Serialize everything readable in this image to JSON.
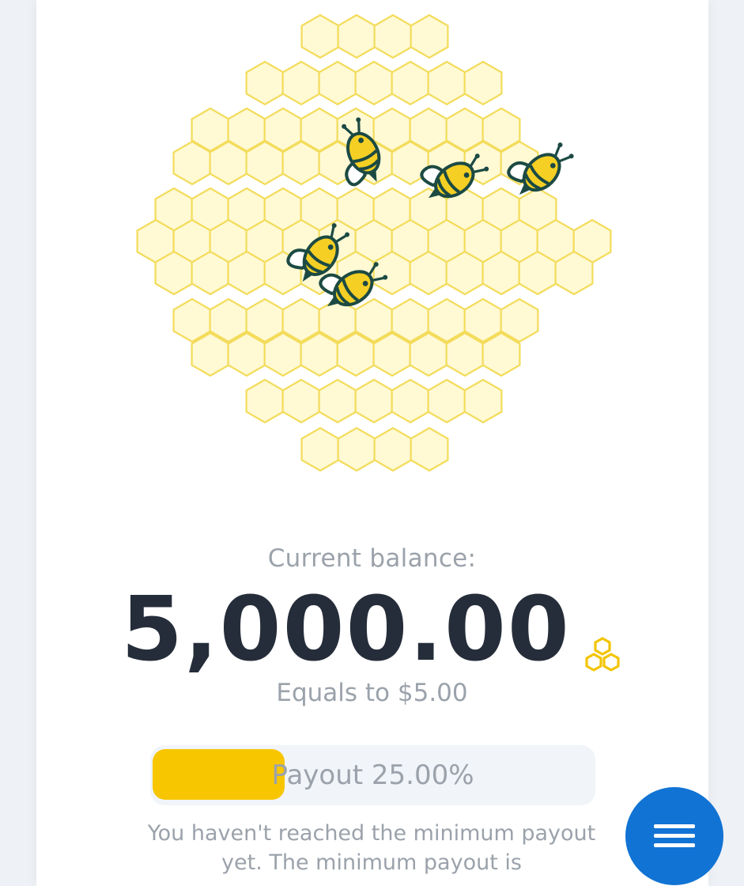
{
  "balance": {
    "label": "Current balance:",
    "value": "5,000.00",
    "equals": "Equals to $5.00",
    "coin_icon": "honeycomb-coin-icon"
  },
  "payout": {
    "label": "Payout 25.00%",
    "progress_percent": 25,
    "fill_color": "#f7c600"
  },
  "notice": {
    "text": "You haven't reached the minimum payout yet. The minimum payout is"
  },
  "menu_button": {
    "icon": "hamburger-menu-icon",
    "color": "#1173d4"
  },
  "colors": {
    "honeycomb_fill": "#fff9d4",
    "honeycomb_stroke": "#f3dc5a",
    "bee_body": "#f5cf24",
    "bee_outline": "#1c4a43",
    "balance_text": "#262d3a",
    "muted_text": "#9ba2ab"
  },
  "hive": {
    "bee_count": 5
  }
}
